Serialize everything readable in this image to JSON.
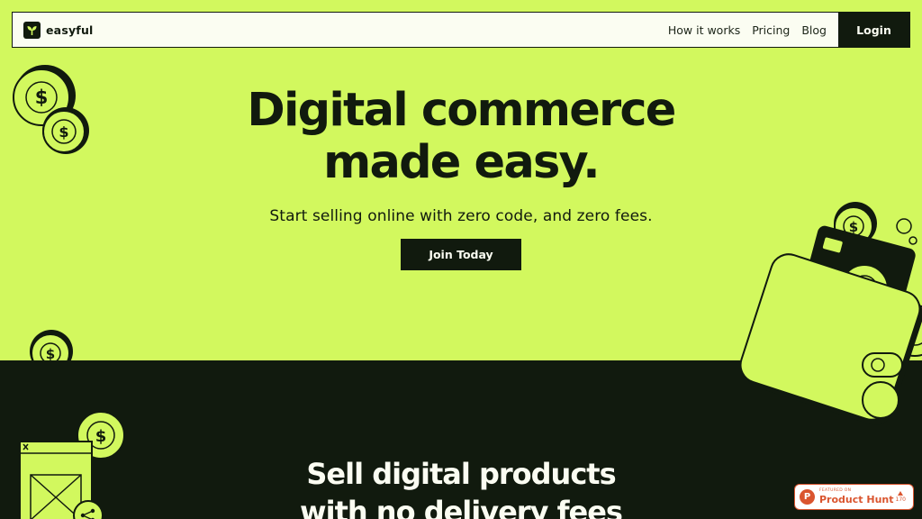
{
  "nav": {
    "brand": "easyful",
    "links": [
      "How it works",
      "Pricing",
      "Blog"
    ],
    "login": "Login"
  },
  "hero": {
    "title_line1": "Digital commerce",
    "title_line2": "made easy.",
    "subtitle": "Start selling online with zero code, and zero fees.",
    "cta": "Join Today"
  },
  "section": {
    "title_line1": "Sell digital products",
    "title_line2": "with no delivery fees"
  },
  "product_hunt": {
    "featured": "FEATURED ON",
    "name": "Product Hunt",
    "votes": "170"
  },
  "icons": {
    "brand_logo": "sprout-icon",
    "coins": "dollar-coin-icon",
    "wallet": "wallet-icon",
    "card": "credit-card-icon",
    "share": "share-icon",
    "close": "close-icon"
  },
  "colors": {
    "background": "#d2f85e",
    "dark": "#111a0e",
    "nav_bg": "#fbfdf2",
    "product_hunt": "#da552f"
  }
}
